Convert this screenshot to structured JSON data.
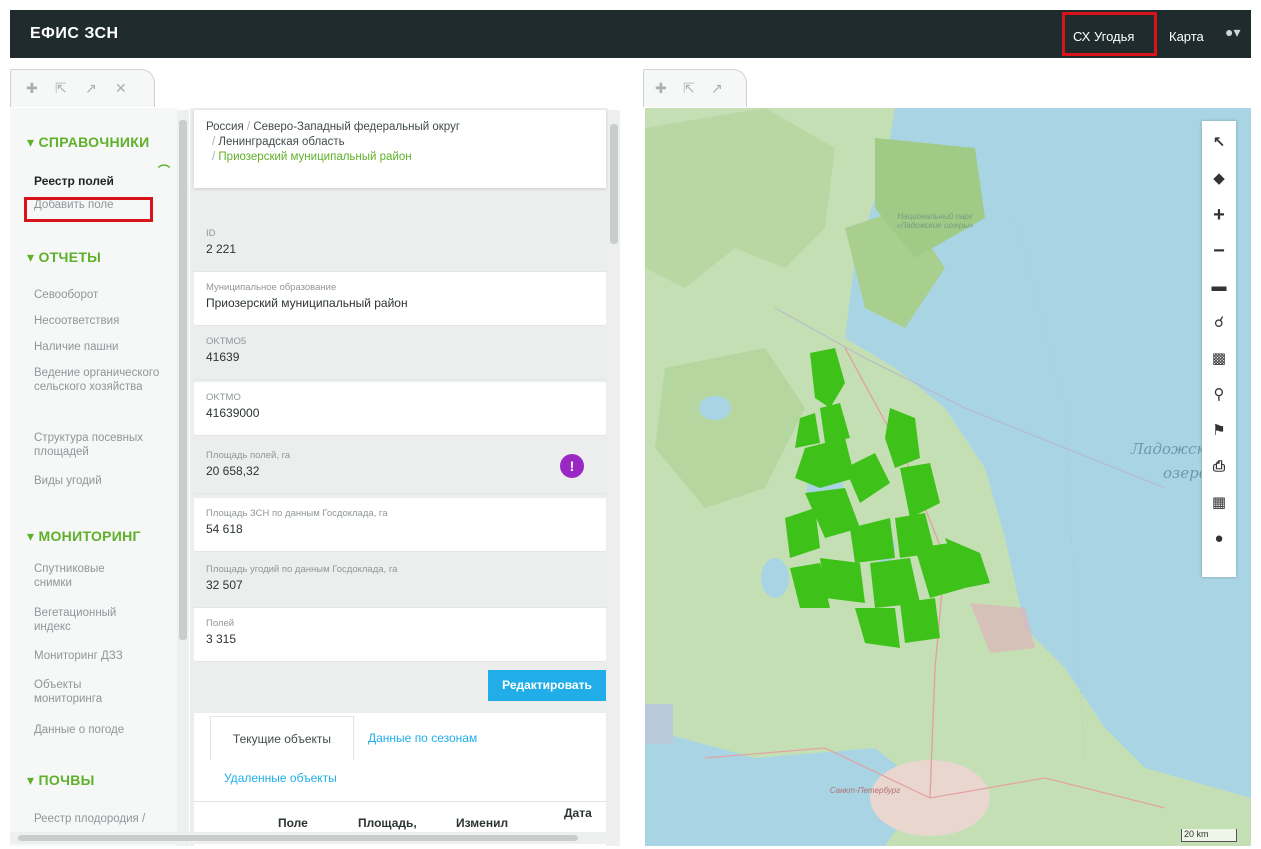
{
  "header": {
    "brand": "ЕФИС ЗСН",
    "nav_agri": "СХ Угодья",
    "nav_map": "Карта",
    "user_icon": "user-icon"
  },
  "sidebar": {
    "sections": [
      {
        "title": "▾ СПРАВОЧНИКИ",
        "items": [
          "Реестр полей",
          "Добавить поле"
        ]
      },
      {
        "title": "▾ ОТЧЕТЫ",
        "items": [
          "Севооборот",
          "Несоответствия",
          "Наличие пашни",
          "Ведение органического сельского хозяйства",
          "Структура посевных площадей",
          "Виды угодий"
        ]
      },
      {
        "title": "▾ МОНИТОРИНГ",
        "items": [
          "Спутниковые снимки",
          "Вегетационный индекс",
          "Мониторинг ДЗЗ",
          "Объекты мониторинга",
          "Данные о погоде"
        ]
      },
      {
        "title": "▾ ПОЧВЫ",
        "items": [
          "Реестр плодородия /"
        ]
      }
    ]
  },
  "breadcrumb": {
    "l1": "Россия",
    "l2": "Северо-Западный федеральный округ",
    "l3": "Ленинградская область",
    "l4": "Приозерский муниципальный район"
  },
  "fields": [
    {
      "label": "ID",
      "value": "2 221"
    },
    {
      "label": "Муниципальное образование",
      "value": "Приозерский муниципальный район"
    },
    {
      "label": "OKTMO5",
      "value": "41639"
    },
    {
      "label": "OKTMO",
      "value": "41639000"
    },
    {
      "label": "Площадь полей, га",
      "value": "20 658,32"
    },
    {
      "label": "Площадь ЗСН по данным Госдоклада, га",
      "value": "54 618"
    },
    {
      "label": "Площадь угодий по данным Госдоклада, га",
      "value": "32 507"
    },
    {
      "label": "Полей",
      "value": "3 315"
    }
  ],
  "edit_button": "Редактировать",
  "tabs": {
    "current": "Текущие объекты",
    "seasons": "Данные по сезонам",
    "deleted": "Удаленные объекты"
  },
  "table_headers": [
    "Поле",
    "Площадь,",
    "Изменил",
    "Дата"
  ],
  "map": {
    "lake_label_1": "Ладожск",
    "lake_label_2": "озеро",
    "park_label": "Национальный парк «Ладожские шхеры»",
    "city_label": "Санкт-Петербург",
    "scale": "20 km"
  },
  "colors": {
    "topbar": "#1f2b2c",
    "accent_green": "#5fb02a",
    "field_green": "#3ec21a",
    "edit_blue": "#21aee8",
    "warn_purple": "#9b27c4",
    "highlight_red": "#d8141a"
  }
}
